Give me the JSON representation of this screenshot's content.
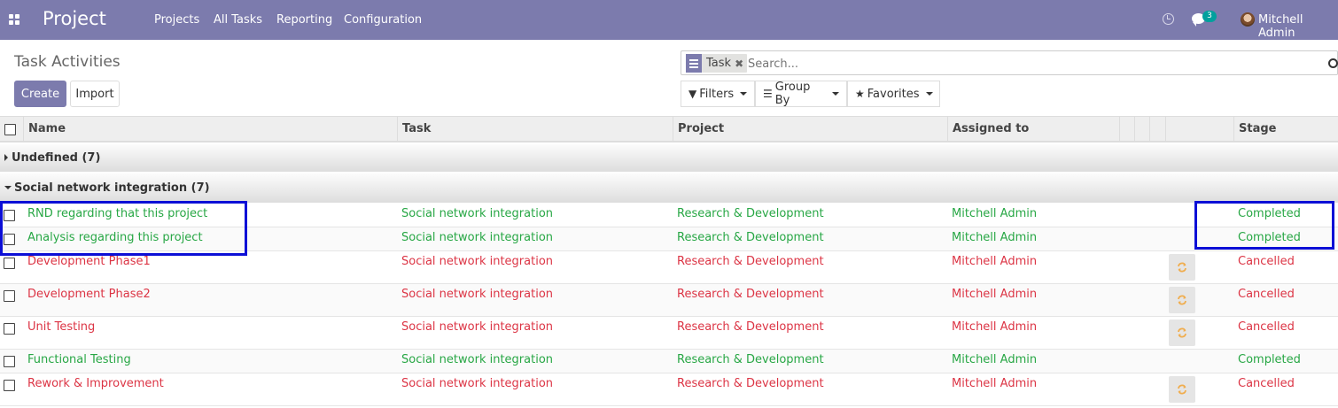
{
  "navbar": {
    "app_title": "Project",
    "menu": [
      "Projects",
      "All Tasks",
      "Reporting",
      "Configuration"
    ],
    "chat_count": "3",
    "user_name": "Mitchell Admin",
    "color": "#7c7bad"
  },
  "control_panel": {
    "title": "Task Activities",
    "create_label": "Create",
    "import_label": "Import",
    "facet_label": "Task",
    "search_placeholder": "Search...",
    "filters_label": "Filters",
    "group_by_label": "Group By",
    "favorites_label": "Favorites"
  },
  "table": {
    "columns": [
      "Name",
      "Task",
      "Project",
      "Assigned to",
      "Stage"
    ],
    "groups": [
      {
        "label": "Undefined (7)",
        "expanded": false
      },
      {
        "label": "Social network integration (7)",
        "expanded": true
      }
    ],
    "rows": [
      {
        "name": "RND regarding that this project",
        "task": "Social network integration",
        "project": "Research & Development",
        "assigned": "Mitchell Admin",
        "stage": "Completed",
        "status": "green",
        "action": false
      },
      {
        "name": "Analysis regarding this project",
        "task": "Social network integration",
        "project": "Research & Development",
        "assigned": "Mitchell Admin",
        "stage": "Completed",
        "status": "green",
        "action": false
      },
      {
        "name": "Development Phase1",
        "task": "Social network integration",
        "project": "Research & Development",
        "assigned": "Mitchell Admin",
        "stage": "Cancelled",
        "status": "red",
        "action": true
      },
      {
        "name": "Development Phase2",
        "task": "Social network integration",
        "project": "Research & Development",
        "assigned": "Mitchell Admin",
        "stage": "Cancelled",
        "status": "red",
        "action": true
      },
      {
        "name": "Unit Testing",
        "task": "Social network integration",
        "project": "Research & Development",
        "assigned": "Mitchell Admin",
        "stage": "Cancelled",
        "status": "red",
        "action": true
      },
      {
        "name": "Functional Testing",
        "task": "Social network integration",
        "project": "Research & Development",
        "assigned": "Mitchell Admin",
        "stage": "Completed",
        "status": "green",
        "action": false
      },
      {
        "name": "Rework & Improvement",
        "task": "Social network integration",
        "project": "Research & Development",
        "assigned": "Mitchell Admin",
        "stage": "Cancelled",
        "status": "red",
        "action": true
      }
    ],
    "colors": {
      "completed": "#28a745",
      "cancelled": "#dc3545",
      "refresh_icon": "#f0ad4e"
    }
  }
}
